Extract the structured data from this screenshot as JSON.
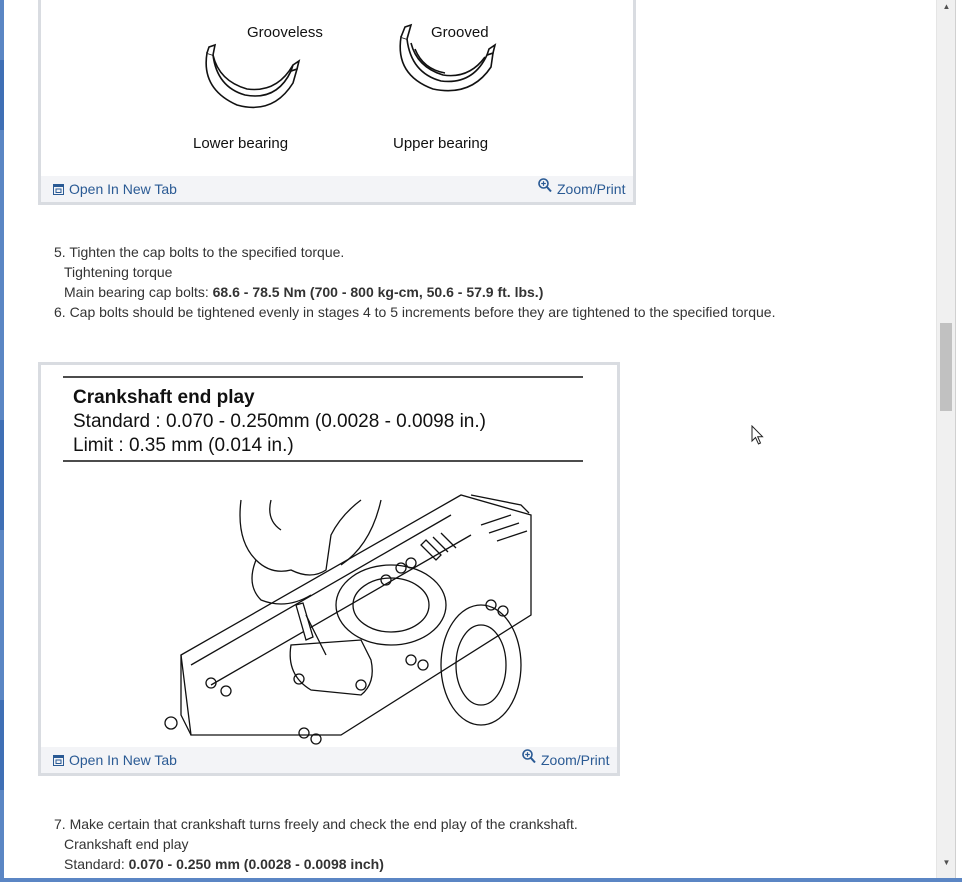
{
  "figures": [
    {
      "labels": {
        "grooveless": "Grooveless",
        "grooved": "Grooved",
        "lower": "Lower bearing",
        "upper": "Upper bearing"
      },
      "open_tab_label": "Open In New Tab",
      "zoom_label": "Zoom/Print"
    },
    {
      "caption_title": "Crankshaft end play",
      "caption_standard": "Standard : 0.070 - 0.250mm (0.0028 - 0.0098 in.)",
      "caption_limit": "Limit :  0.35 mm (0.014 in.)",
      "open_tab_label": "Open In New Tab",
      "zoom_label": "Zoom/Print"
    }
  ],
  "steps": {
    "step5": {
      "text": "5. Tighten the cap bolts to the specified torque.",
      "sub1": "Tightening torque",
      "sub2_prefix": "Main bearing cap bolts: ",
      "sub2_value": "68.6 - 78.5 Nm (700 - 800 kg-cm, 50.6 - 57.9 ft. lbs.)"
    },
    "step6": {
      "text": "6. Cap bolts should be tightened evenly in stages 4 to 5 increments before they are tightened to the specified torque."
    },
    "step7": {
      "text": "7. Make certain that crankshaft turns freely and check the end play of the crankshaft.",
      "sub1": "Crankshaft end play",
      "sub2_prefix": "Standard: ",
      "sub2_value": "0.070 - 0.250 mm (0.0028 - 0.0098 inch)"
    }
  },
  "icons": {
    "open_tab": "open-new-tab-icon",
    "zoom": "magnifier-zoom-icon",
    "cursor": "mouse-pointer-icon"
  },
  "colors": {
    "link": "#2a5a94",
    "frame": "#d9dce1",
    "footer_bg": "#f3f4f7",
    "window_edge": "#5b86c4"
  }
}
